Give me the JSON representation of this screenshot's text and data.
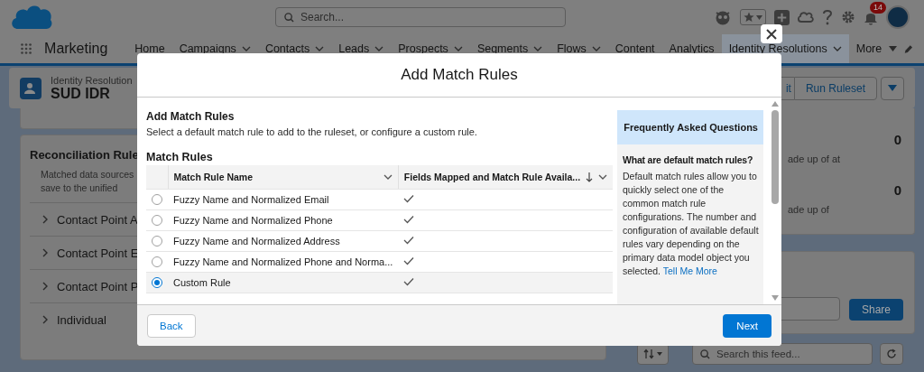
{
  "global_header": {
    "search": {
      "placeholder": "Search..."
    },
    "notification_count": "14"
  },
  "nav": {
    "app_name": "Marketing",
    "items": [
      {
        "label": "Home",
        "has_menu": false,
        "selected": false
      },
      {
        "label": "Campaigns",
        "has_menu": true,
        "selected": false
      },
      {
        "label": "Contacts",
        "has_menu": true,
        "selected": false
      },
      {
        "label": "Leads",
        "has_menu": true,
        "selected": false
      },
      {
        "label": "Prospects",
        "has_menu": true,
        "selected": false
      },
      {
        "label": "Segments",
        "has_menu": true,
        "selected": false
      },
      {
        "label": "Flows",
        "has_menu": true,
        "selected": false
      },
      {
        "label": "Content",
        "has_menu": false,
        "selected": false
      },
      {
        "label": "Analytics",
        "has_menu": false,
        "selected": false
      },
      {
        "label": "Identity Resolutions",
        "has_menu": true,
        "selected": true
      }
    ],
    "more": "More"
  },
  "record_header": {
    "object_type": "Identity Resolution",
    "title": "SUD IDR",
    "buttons": [
      "it",
      "Run Ruleset"
    ]
  },
  "left_card": {
    "title": "Reconciliation Rule",
    "description_lines": [
      "Matched data sources",
      "save to the unified"
    ],
    "sections": [
      {
        "label": "Contact Point A",
        "expanded": false
      },
      {
        "label": "Contact Point E",
        "expanded": false
      },
      {
        "label": "Contact Point P",
        "expanded": false
      },
      {
        "label": "Individual",
        "expanded": false
      }
    ]
  },
  "right_panel": {
    "stats": [
      {
        "fragment": "ade up of at",
        "value": "0"
      },
      {
        "fragment": "ade up of",
        "value": "0"
      }
    ],
    "share_button": "Share",
    "feed_search": {
      "placeholder": "Search this feed..."
    }
  },
  "modal": {
    "title": "Add Match Rules",
    "section_title": "Add Match Rules",
    "description": "Select a default match rule to add to the ruleset, or configure a custom rule.",
    "table_title": "Match Rules",
    "columns": [
      {
        "label": "Match Rule Name",
        "sorted": false
      },
      {
        "label": "Fields Mapped and Match Rule Availa...",
        "sorted": true
      }
    ],
    "rows": [
      {
        "name": "Fuzzy Name and Normalized Email",
        "available": true,
        "selected": false
      },
      {
        "name": "Fuzzy Name and Normalized Phone",
        "available": true,
        "selected": false
      },
      {
        "name": "Fuzzy Name and Normalized Address",
        "available": true,
        "selected": false
      },
      {
        "name": "Fuzzy Name and Normalized Phone and Norma...",
        "available": true,
        "selected": false
      },
      {
        "name": "Custom Rule",
        "available": true,
        "selected": true
      }
    ],
    "faq": {
      "heading": "Frequently Asked Questions",
      "question": "What are default match rules?",
      "answer": "Default match rules allow you to quickly select one of the common match rule configurations. The number and configuration of available default rules vary depending on the primary data model object you selected.",
      "link": "Tell Me More"
    },
    "back_button": "Back",
    "next_button": "Next"
  }
}
